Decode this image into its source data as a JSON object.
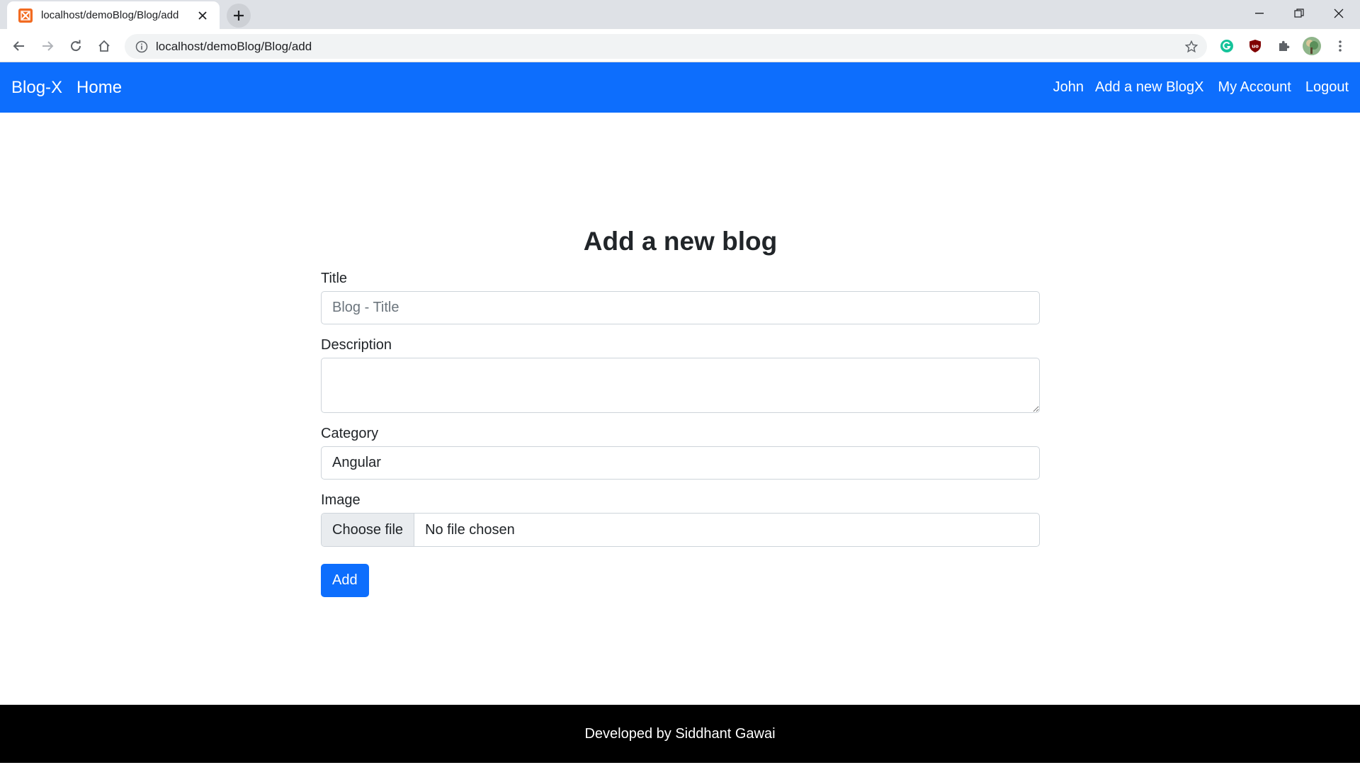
{
  "browser": {
    "tab_title": "localhost/demoBlog/Blog/add",
    "url": "localhost/demoBlog/Blog/add"
  },
  "navbar": {
    "brand": "Blog-X",
    "home": "Home",
    "user": "John",
    "add_new": "Add a new BlogX",
    "account": "My Account",
    "logout": "Logout",
    "color": "#0d6efd"
  },
  "form": {
    "heading": "Add a new blog",
    "title_label": "Title",
    "title_placeholder": "Blog - Title",
    "description_label": "Description",
    "category_label": "Category",
    "category_value": "Angular",
    "image_label": "Image",
    "choose_file": "Choose file",
    "no_file": "No file chosen",
    "submit": "Add"
  },
  "footer": {
    "text": "Developed by Siddhant Gawai"
  }
}
